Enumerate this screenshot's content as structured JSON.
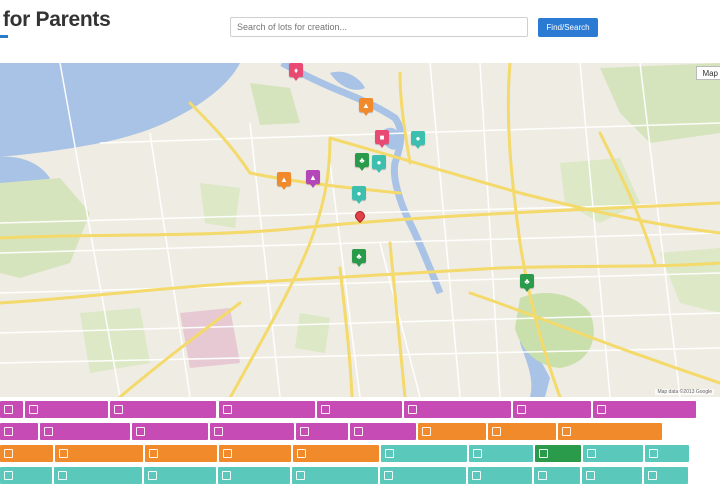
{
  "header": {
    "logo_text": "e for Parents",
    "search_placeholder": "Search of lots for creation...",
    "search_button": "Find/Search"
  },
  "map": {
    "map_type_label": "Map",
    "attribution": "Map data ©2013 Google",
    "colors": {
      "water": "#a9c3e6",
      "land": "#efece3",
      "park": "#c9dfac",
      "road_major": "#f7e07a",
      "road_minor": "#ffffff"
    },
    "markers": [
      {
        "category": "purple",
        "color": "#c9439e",
        "icon": "child-icon"
      },
      {
        "category": "orange",
        "color": "#f08a2a",
        "icon": "school-icon"
      },
      {
        "category": "pink",
        "color": "#e84a73",
        "icon": "theatre-icon"
      },
      {
        "category": "teal",
        "color": "#3dbfb0",
        "icon": "cafe-icon"
      },
      {
        "category": "green",
        "color": "#2a9b4a",
        "icon": "park-icon"
      },
      {
        "category": "purple",
        "color": "#b347b8",
        "icon": "museum-icon"
      },
      {
        "category": "orange",
        "color": "#f08a2a",
        "icon": "school-icon"
      },
      {
        "category": "teal",
        "color": "#3dbfb0",
        "icon": "cafe-icon"
      },
      {
        "category": "green",
        "color": "#2a9b4a",
        "icon": "park-icon"
      },
      {
        "category": "green",
        "color": "#2a9b4a",
        "icon": "park-icon"
      },
      {
        "category": "green",
        "color": "#2a9b4a",
        "icon": "park-icon"
      },
      {
        "category": "red",
        "color": "#e0404a",
        "icon": "location-pin-icon"
      }
    ]
  },
  "tags": {
    "rows": [
      [
        {
          "label": "",
          "color": "#c74bb5"
        },
        {
          "label": "",
          "color": "#c74bb5"
        },
        {
          "label": "",
          "color": "#c74bb5"
        },
        {
          "label": "",
          "color": "#c74bb5"
        },
        {
          "label": "",
          "color": "#c74bb5"
        },
        {
          "label": "",
          "color": "#c74bb5"
        },
        {
          "label": "",
          "color": "#c74bb5"
        },
        {
          "label": "",
          "color": "#c74bb5"
        }
      ],
      [
        {
          "label": "",
          "color": "#c74bb5"
        },
        {
          "label": "",
          "color": "#c74bb5"
        },
        {
          "label": "",
          "color": "#c74bb5"
        },
        {
          "label": "",
          "color": "#c74bb5"
        },
        {
          "label": "",
          "color": "#c74bb5"
        },
        {
          "label": "",
          "color": "#c74bb5"
        },
        {
          "label": "",
          "color": "#c74bb5"
        },
        {
          "label": "",
          "color": "#f08a2a"
        },
        {
          "label": "",
          "color": "#f08a2a"
        },
        {
          "label": "",
          "color": "#f08a2a"
        }
      ],
      [
        {
          "label": "",
          "color": "#f08a2a"
        },
        {
          "label": "",
          "color": "#f08a2a"
        },
        {
          "label": "",
          "color": "#f08a2a"
        },
        {
          "label": "",
          "color": "#f08a2a"
        },
        {
          "label": "",
          "color": "#f08a2a"
        },
        {
          "label": "",
          "color": "#5ac9bb"
        },
        {
          "label": "",
          "color": "#5ac9bb"
        },
        {
          "label": "",
          "color": "#5ac9bb"
        },
        {
          "label": "",
          "color": "#5ac9bb"
        },
        {
          "label": "",
          "color": "#2a9b4a"
        },
        {
          "label": "",
          "color": "#5ac9bb"
        },
        {
          "label": "",
          "color": "#5ac9bb"
        }
      ]
    ]
  }
}
